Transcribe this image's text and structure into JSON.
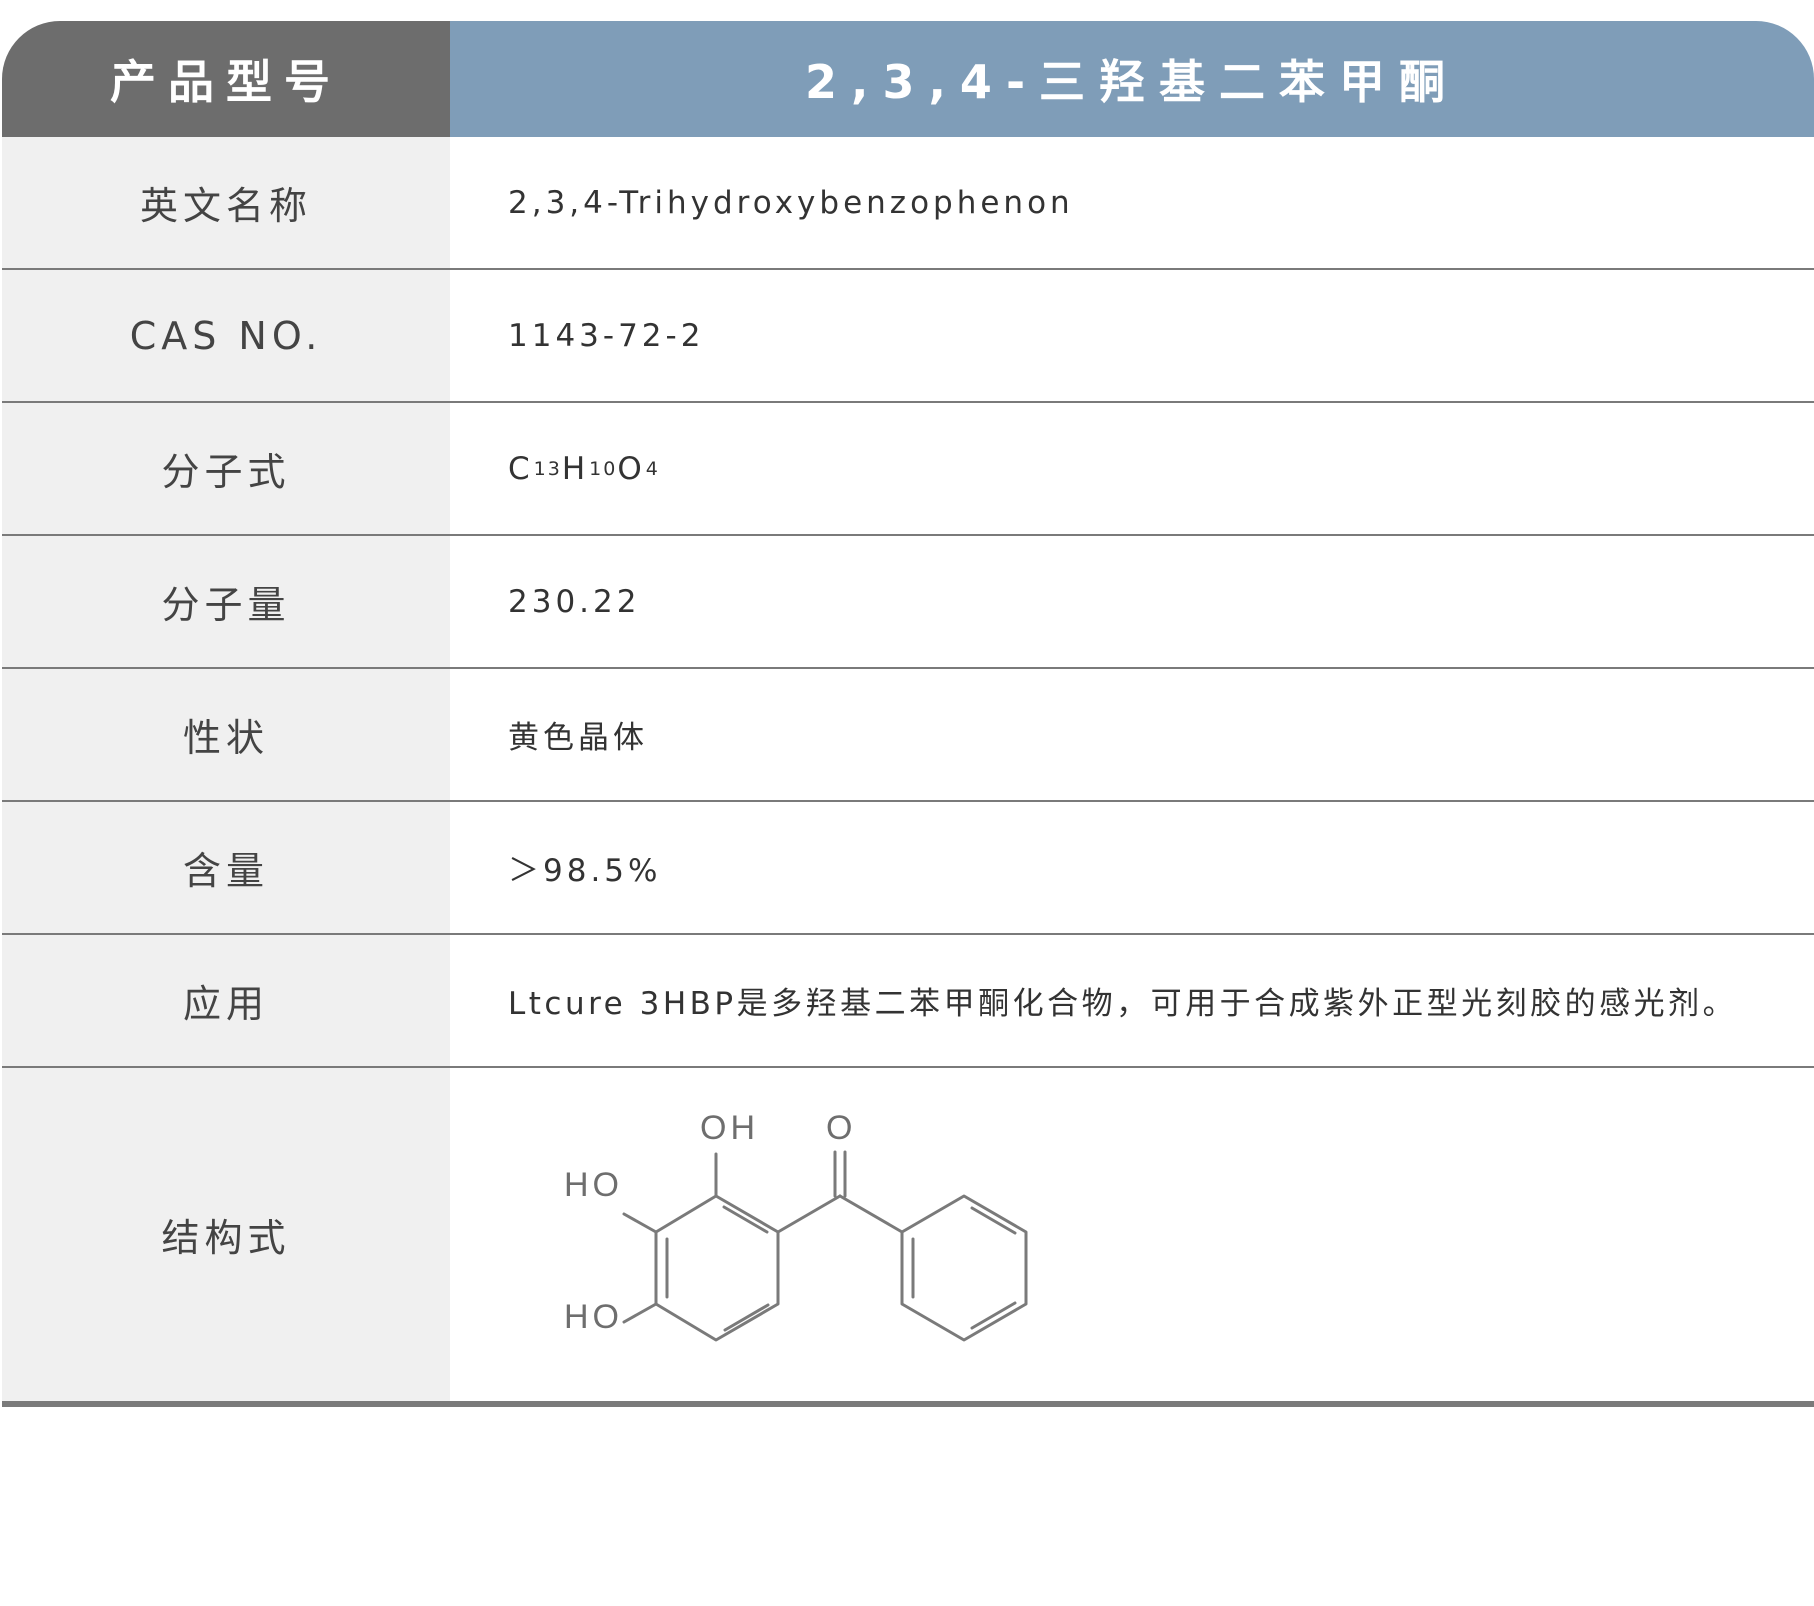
{
  "header": {
    "label": "产品型号",
    "value": "2,3,4-三羟基二苯甲酮"
  },
  "rows": [
    {
      "label": "英文名称",
      "value": "2,3,4-Trihydroxybenzophenon"
    },
    {
      "label": "CAS NO.",
      "value": "1143-72-2"
    },
    {
      "label": "分子式",
      "formula": {
        "c": "C",
        "c_sub": "13",
        "h": "H",
        "h_sub": "10",
        "o": "O",
        "o_sub": "4"
      }
    },
    {
      "label": "分子量",
      "value": "230.22"
    },
    {
      "label": "性状",
      "value": "黄色晶体"
    },
    {
      "label": "含量",
      "value": "＞98.5%"
    },
    {
      "label": "应用",
      "value": "Ltcure 3HBP是多羟基二苯甲酮化合物，可用于合成紫外正型光刻胶的感光剂。"
    },
    {
      "label": "结构式",
      "structure_labels": {
        "oh_top": "OH",
        "o_top": "O",
        "ho_mid": "HO",
        "ho_bottom": "HO"
      }
    }
  ]
}
